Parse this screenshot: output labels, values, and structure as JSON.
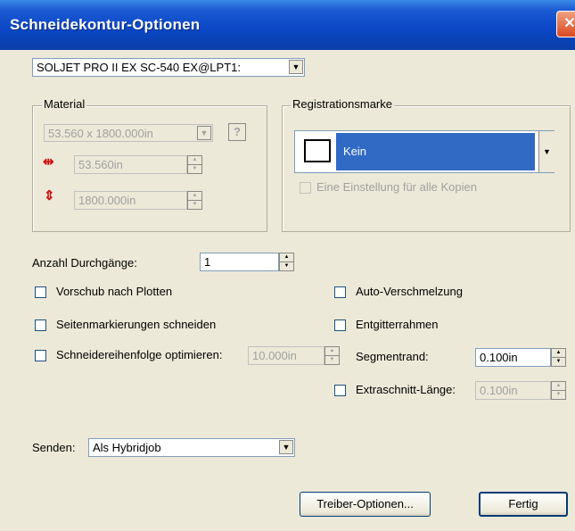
{
  "window": {
    "title": "Schneidekontur-Optionen",
    "close_label": "✕"
  },
  "device": {
    "selected": "SOLJET PRO II EX SC-540 EX@LPT1:"
  },
  "material": {
    "legend": "Material",
    "size_selected": "53.560 x 1800.000in",
    "width_value": "53.560in",
    "height_value": "1800.000in",
    "help_label": "?"
  },
  "registration": {
    "legend": "Registrationsmarke",
    "selected": "Kein",
    "one_setting_label": "Eine Einstellung für alle Kopien"
  },
  "passes": {
    "label": "Anzahl Durchgänge:",
    "value": "1"
  },
  "options": {
    "feed_after_plot": "Vorschub nach Plotten",
    "cut_page_marks": "Seitenmarkierungen schneiden",
    "optimize_order": "Schneidereihenfolge optimieren:",
    "optimize_value": "10.000in",
    "auto_merge": "Auto-Verschmelzung",
    "weeding_frame": "Entgitterrahmen",
    "segment_margin_label": "Segmentrand:",
    "segment_margin_value": "0.100in",
    "extra_cut_label": "Extraschnitt-Länge:",
    "extra_cut_value": "0.100in"
  },
  "send": {
    "label": "Senden:",
    "selected": "Als Hybridjob"
  },
  "buttons": {
    "driver_options": "Treiber-Optionen...",
    "done": "Fertig"
  }
}
